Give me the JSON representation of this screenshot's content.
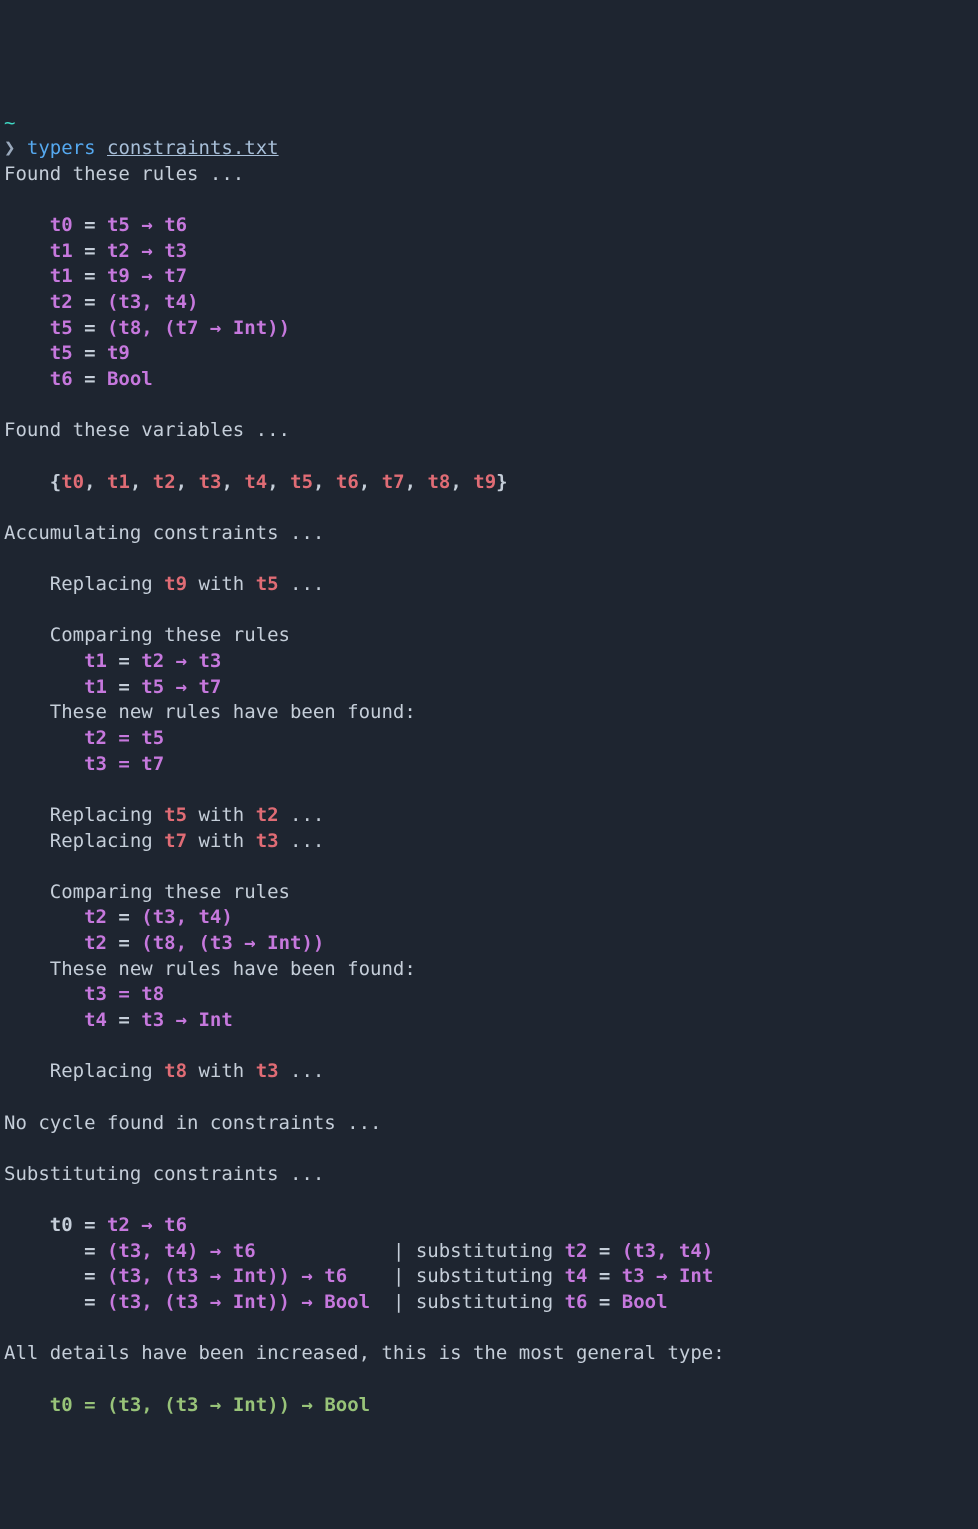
{
  "prompt": {
    "tilde": "~",
    "caret": "❯",
    "command": "typers",
    "filename": "constraints.txt"
  },
  "headers": {
    "found_rules": "Found these rules ...",
    "found_vars": "Found these variables ...",
    "accumulating": "Accumulating constraints ...",
    "no_cycle": "No cycle found in constraints ...",
    "substituting": "Substituting constraints ...",
    "all_details": "All details have been increased, this is the most general type:"
  },
  "rules": {
    "r0": "t0",
    "r0eq": " = ",
    "r0a": "t5",
    "r0arr": " → ",
    "r0b": "t6",
    "r1": "t1",
    "r1a": "t2",
    "r1b": "t3",
    "r2": "t1",
    "r2a": "t9",
    "r2b": "t7",
    "r3": "t2",
    "r3v": "(t3, t4)",
    "r4": "t5",
    "r4v": "(t8, (t7 → Int))",
    "r5": "t5",
    "r5b": "t9",
    "r6": "t6",
    "r6b": "Bool"
  },
  "vars": {
    "open": "{",
    "close": "}",
    "list": [
      "t0",
      "t1",
      "t2",
      "t3",
      "t4",
      "t5",
      "t6",
      "t7",
      "t8",
      "t9"
    ]
  },
  "steps": {
    "replacing": "Replacing ",
    "with": " with ",
    "dots": " ...",
    "comparing": "Comparing these rules",
    "newrules": "These new rules have been found:",
    "rep1a": "t9",
    "rep1b": "t5",
    "cmp1a": "t1",
    "cmp1a_r": "t2 → t3",
    "cmp1b": "t1",
    "cmp1b_r": "t5 → t7",
    "new1a": "t2 = t5",
    "new1b": "t3 = t7",
    "rep2a": "t5",
    "rep2b": "t2",
    "rep3a": "t7",
    "rep3b": "t3",
    "cmp2a": "t2",
    "cmp2a_r": "(t3, t4)",
    "cmp2b": "t2",
    "cmp2b_r": "(t8, (t3 → Int))",
    "new2a": "t3 = t8",
    "new2b_l": "t4",
    "new2b_r": "t3 → Int",
    "rep4a": "t8",
    "rep4b": "t3"
  },
  "subst": {
    "l0a": "t0 = ",
    "l0b": "t2 → t6",
    "l1a": "   = ",
    "l1b": "(t3, t4) → t6",
    "l2b": "(t3, (t3 → Int)) → t6",
    "l3b": "(t3, (t3 → Int)) → Bool",
    "pipe": "|",
    "word": " substituting ",
    "s1l": "t2",
    "s1r": "(t3, t4)",
    "s2l": "t4",
    "s2r": "t3 → Int",
    "s3l": "t6",
    "s3r": "Bool"
  },
  "final": {
    "lhs": "t0",
    "eq": " = ",
    "rhs": "(t3, (t3 → Int)) → Bool"
  }
}
